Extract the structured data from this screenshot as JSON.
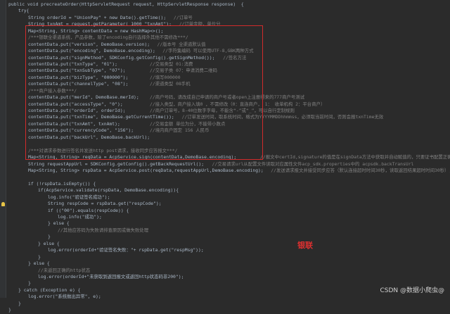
{
  "code_lines": [
    {
      "indent": 0,
      "text": "public void precreateOrder(HttpServletRequest request, HttpServletResponse response)  {",
      "comment": ""
    },
    {
      "indent": 1,
      "text": "try{",
      "comment": ""
    },
    {
      "indent": 2,
      "text": "String orderId = \"UnionPay\" + new Date().getTime();",
      "comment": "//订单号"
    },
    {
      "indent": 2,
      "text": "String txnAmt = request.getParameter( 1000 \"txnAmt\");",
      "comment": "//订单金额，单位分"
    },
    {
      "indent": 2,
      "text": "Map<String, String> contentData = new HashMap<>();",
      "comment": ""
    },
    {
      "indent": 2,
      "text": "/***银联全渠道系统，产品参数，除了encoding自行选择外其他不需修改***/",
      "comment": ""
    },
    {
      "indent": 2,
      "text": "contentData.put(\"version\", DemoBase.version);",
      "comment": "//版本号 全渠道默认值"
    },
    {
      "indent": 2,
      "text": "contentData.put(\"encoding\", DemoBase.encoding);",
      "comment": "//字符集编码 可以使用UTF-8,GBK两种方式"
    },
    {
      "indent": 2,
      "text": "contentData.put(\"signMethod\", SDKConfig.getConfig().getSignMethod());",
      "comment": "//签名方法"
    },
    {
      "indent": 2,
      "text": "contentData.put(\"txnType\", \"01\");",
      "comment": "//交易类型 01:消费"
    },
    {
      "indent": 2,
      "text": "contentData.put(\"txnSubType\", \"07\");",
      "comment": "//交易子类 07：申请消费二维码"
    },
    {
      "indent": 2,
      "text": "contentData.put(\"bizType\", \"000000\");",
      "comment": "//填写000000"
    },
    {
      "indent": 2,
      "text": "contentData.put(\"channelType\", \"08\");",
      "comment": "//渠道类型 08手机"
    },
    {
      "indent": 2,
      "text": "/***商户接入参数***/",
      "comment": ""
    },
    {
      "indent": 2,
      "text": "contentData.put(\"merId\", DemoBase.merId);",
      "comment": "//商户号码，请改成自己申请的商户号或者open上注册得来的777商户号测试"
    },
    {
      "indent": 2,
      "text": "contentData.put(\"accessType\", \"0\");",
      "comment": "//接入类型，商户接入填0 ，不需修改（0：直连商户， 1： 收单机构 2：平台商户）"
    },
    {
      "indent": 2,
      "text": "contentData.put(\"orderId\", orderId);",
      "comment": "//商户订单号，8-40位数字字母，不能含“-”或“_”，可以自行定制规则"
    },
    {
      "indent": 2,
      "text": "contentData.put(\"txnTime\", DemoBase.getCurrentTime());",
      "comment": "//订单发送时间，取系统时间，格式为YYYYMMDDhhmmss，必须取当前时间，否则会报txnTime无效"
    },
    {
      "indent": 2,
      "text": "contentData.put(\"txnAmt\", txnAmt);",
      "comment": "//交易金额 单位为分，不能带小数点"
    },
    {
      "indent": 2,
      "text": "contentData.put(\"currencyCode\", \"156\");",
      "comment": "//境内商户固定 156 人民币"
    },
    {
      "indent": 2,
      "text": "contentData.put(\"backUrl\", DemoBase.backUrl);",
      "comment": ""
    },
    {
      "indent": 2,
      "text": "",
      "comment": ""
    },
    {
      "indent": 2,
      "text": "/***对请求参数进行签名并发送http post请求，接收同步应答报文***/",
      "comment": ""
    },
    {
      "indent": 2,
      "text": "Map<String, String> reqData = AcpService.sign(contentData,DemoBase.encoding);",
      "comment": "//报文中certId,signature的值是在signData方法中获取并自动赋值的，只要证书配置正确即可。"
    },
    {
      "indent": 2,
      "text": "String requestAppUrl = SDKConfig.getConfig().getBackRequestUrl();",
      "comment": "//交易请求url从配置文件读取对应属性文件acp_sdk.properties中的 acpsdk.backTransUrl"
    },
    {
      "indent": 2,
      "text": "Map<String, String> rspData = AcpService.post(reqData,requestAppUrl,DemoBase.encoding);",
      "comment": "//发送请求报文并接受同步应答（默认连接超时时间30秒，读取返回结果超时时间30秒）;这里调用"
    },
    {
      "indent": 2,
      "text": "",
      "comment": ""
    },
    {
      "indent": 2,
      "text": "if (!rspData.isEmpty()) {",
      "comment": ""
    },
    {
      "indent": 3,
      "text": "if(AcpService.validate(rspData, DemoBase.encoding)){",
      "comment": ""
    },
    {
      "indent": 4,
      "text": "log.info(\"验证签名成功\");",
      "comment": ""
    },
    {
      "indent": 4,
      "text": "String respCode = rspData.get(\"respCode\");",
      "comment": ""
    },
    {
      "indent": 4,
      "text": "if ((\"00\").equals(respCode)) {",
      "comment": ""
    },
    {
      "indent": 5,
      "text": "log.info(\"成功\");",
      "comment": ""
    },
    {
      "indent": 4,
      "text": "} else {",
      "comment": ""
    },
    {
      "indent": 5,
      "text": "//其他应答码为失败请排查原因或做失败处理",
      "comment": ""
    },
    {
      "indent": 4,
      "text": "}",
      "comment": ""
    },
    {
      "indent": 3,
      "text": "} else {",
      "comment": ""
    },
    {
      "indent": 4,
      "text": "log.error(orderId+\"验证签名失败：\"+ rspData.get(\"respMsg\"));",
      "comment": ""
    },
    {
      "indent": 3,
      "text": "}",
      "comment": ""
    },
    {
      "indent": 2,
      "text": "} else {",
      "comment": ""
    },
    {
      "indent": 3,
      "text": "//未返回正确的http状态",
      "comment": ""
    },
    {
      "indent": 3,
      "text": "log.error(orderId+\"未获取到返回报文或返回http状态码非200\");",
      "comment": ""
    },
    {
      "indent": 2,
      "text": "}",
      "comment": ""
    },
    {
      "indent": 1,
      "text": "} catch (Exception e) {",
      "comment": ""
    },
    {
      "indent": 2,
      "text": "log.error(\"系统抛出异常\", e);",
      "comment": ""
    },
    {
      "indent": 1,
      "text": "}",
      "comment": ""
    },
    {
      "indent": 0,
      "text": "}",
      "comment": ""
    }
  ],
  "annotation": {
    "label": "银联"
  },
  "watermark": "CSDN @数据小爬虫@"
}
